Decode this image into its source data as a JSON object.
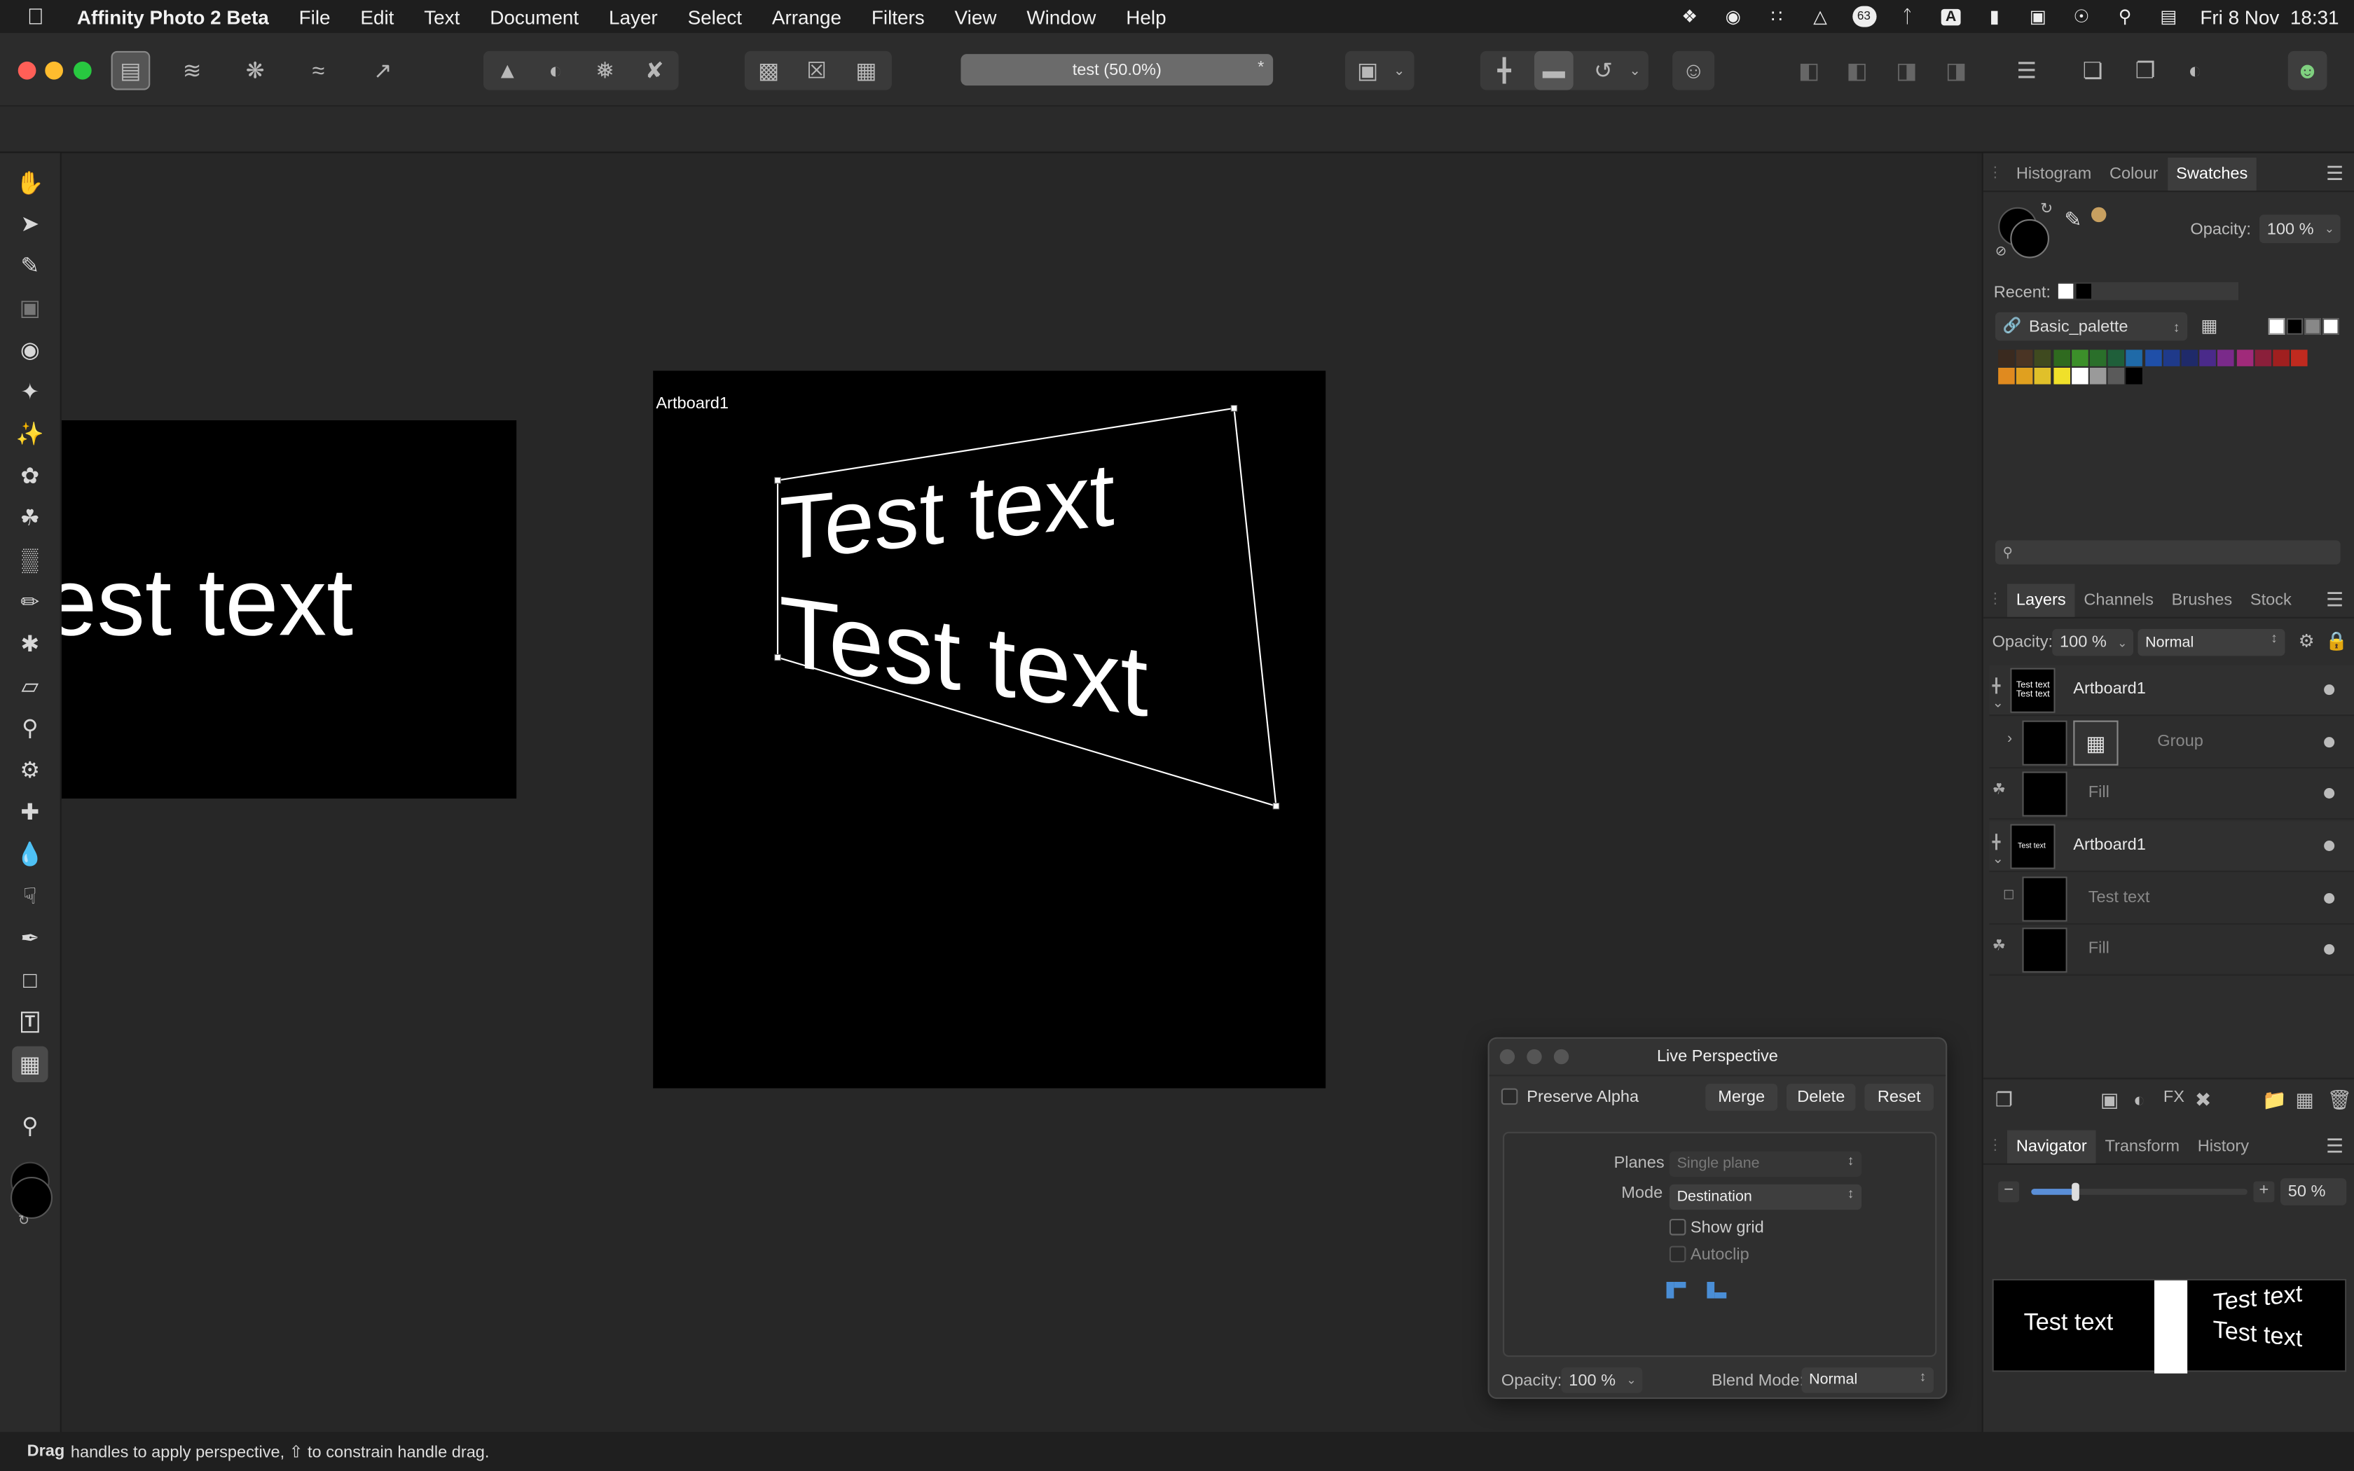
{
  "menubar": {
    "app_name": "Affinity Photo 2 Beta",
    "items": [
      "File",
      "Edit",
      "Text",
      "Document",
      "Layer",
      "Select",
      "Arrange",
      "Filters",
      "View",
      "Window",
      "Help"
    ],
    "date_time": "Fri 8 Nov  18:31",
    "badge_count": "63",
    "input_source": "A"
  },
  "toolbar": {
    "document_tab": "test (50.0%)",
    "document_tab_star": "*"
  },
  "canvas": {
    "left_artboard_text": "est text",
    "main_artboard_label": "Artboard1",
    "main_text_line1": "Test text",
    "main_text_line2": "Test text"
  },
  "status": {
    "bold": "Drag",
    "text": "handles to apply perspective, ⇧ to constrain handle drag."
  },
  "swatches_panel": {
    "tabs": [
      "Histogram",
      "Colour",
      "Swatches"
    ],
    "active_tab": "Swatches",
    "opacity_label": "Opacity:",
    "opacity_value": "100 %",
    "recent_label": "Recent:",
    "palette_name": "Basic_palette",
    "palette_row1": [
      "#3a2a1f",
      "#4a3424",
      "#3f4a1f",
      "#2f6a1f",
      "#3c8f2a",
      "#2a6f2a",
      "#1f5f3a",
      "#1f6aa8",
      "#1f4fa8",
      "#1f3a8a",
      "#1f2a6a",
      "#4a2a8a",
      "#7a2a8a",
      "#a02a7a",
      "#8a1f3a",
      "#a01f1f",
      "#c02a1f"
    ],
    "palette_row2": [
      "#e08a1f",
      "#e0a01f",
      "#e0c02a",
      "#f0e02a",
      "#ffffff",
      "#9a9a9a",
      "#5a5a5a",
      "#000000"
    ],
    "recent_colors": [
      "#ffffff",
      "#000000"
    ]
  },
  "layers_panel": {
    "tabs": [
      "Layers",
      "Channels",
      "Brushes",
      "Stock"
    ],
    "active_tab": "Layers",
    "opacity_label": "Opacity:",
    "opacity_value": "100 %",
    "blend_mode": "Normal",
    "layers": [
      {
        "name": "Artboard1"
      },
      {
        "name": "Group"
      },
      {
        "name": "Fill"
      },
      {
        "name": "Artboard1"
      },
      {
        "name": "Test text"
      },
      {
        "name": "Fill"
      }
    ]
  },
  "navigator_panel": {
    "tabs": [
      "Navigator",
      "Transform",
      "History"
    ],
    "active_tab": "Navigator",
    "zoom_value": "50 %",
    "zoom_fraction": 0.2,
    "preview_left_text": "Test text",
    "preview_right_line1": "Test text",
    "preview_right_line2": "Test text"
  },
  "live_perspective": {
    "title": "Live Perspective",
    "preserve_alpha_label": "Preserve Alpha",
    "merge_label": "Merge",
    "delete_label": "Delete",
    "reset_label": "Reset",
    "planes_label": "Planes",
    "planes_value": "Single plane",
    "mode_label": "Mode",
    "mode_value": "Destination",
    "show_grid_label": "Show grid",
    "autoclip_label": "Autoclip",
    "opacity_label": "Opacity:",
    "opacity_value": "100 %",
    "blend_mode_label": "Blend Mode:",
    "blend_mode_value": "Normal"
  },
  "colors": {
    "accent": "#5a8fd8",
    "primary_colour": "#000000",
    "secondary_colour": "#111111"
  }
}
